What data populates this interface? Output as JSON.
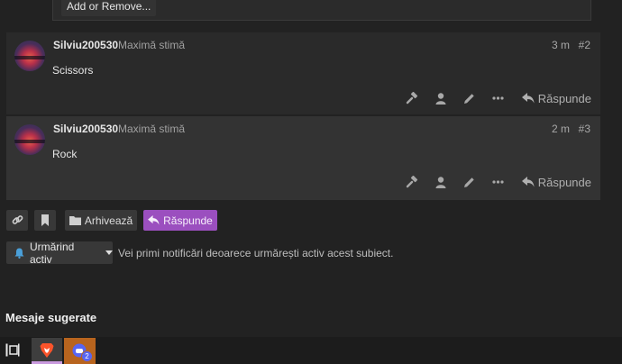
{
  "top": {
    "add_remove_label": "Add or Remove..."
  },
  "posts": [
    {
      "username": "Silviu200530",
      "user_title": "Maximă stimă",
      "time": "3 m",
      "number": "#2",
      "body": "Scissors",
      "reply_label": "Răspunde"
    },
    {
      "username": "Silviu200530",
      "user_title": "Maximă stimă",
      "time": "2 m",
      "number": "#3",
      "body": "Rock",
      "reply_label": "Răspunde"
    }
  ],
  "controls": {
    "archive_label": "Arhivează",
    "reply_label": "Răspunde"
  },
  "notification": {
    "level_label": "Urmărind activ",
    "description": "Vei primi notificări deoarece urmărești activ acest subiect."
  },
  "suggested": {
    "title": "Mesaje sugerate"
  },
  "taskbar": {
    "app_badge": "2"
  },
  "colors": {
    "accent": "#9b4fbf",
    "background": "#222222"
  }
}
